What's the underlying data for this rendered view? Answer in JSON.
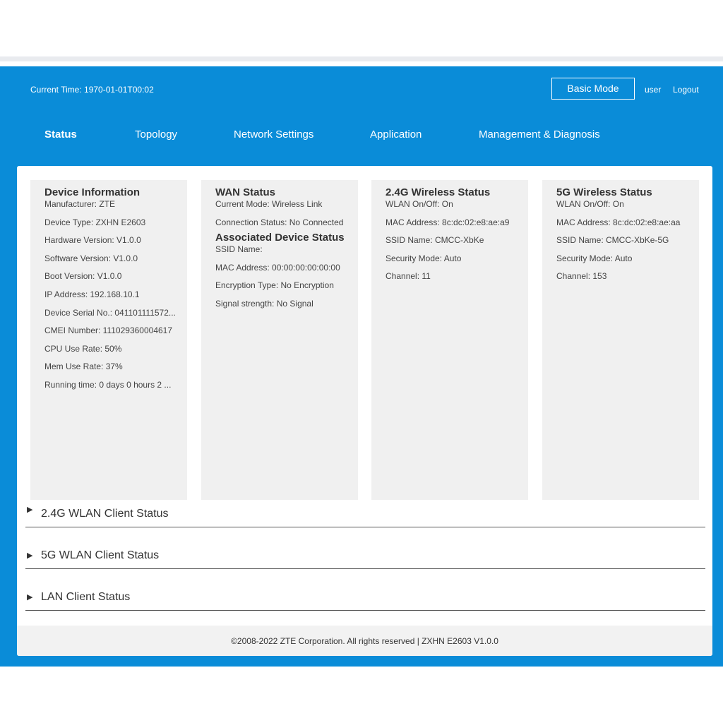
{
  "header": {
    "current_time": "Current Time: 1970-01-01T00:02",
    "basic_mode": "Basic Mode",
    "user": "user",
    "logout": "Logout"
  },
  "nav": [
    {
      "label": "Status",
      "active": true
    },
    {
      "label": "Topology"
    },
    {
      "label": "Network Settings"
    },
    {
      "label": "Application"
    },
    {
      "label": "Management & Diagnosis"
    }
  ],
  "device_info": {
    "title": "Device Information",
    "rows": [
      "Manufacturer: ZTE",
      "Device Type: ZXHN E2603",
      "Hardware Version: V1.0.0",
      "Software Version: V1.0.0",
      "Boot Version: V1.0.0",
      "IP Address: 192.168.10.1",
      "Device Serial No.: 041101111572...",
      "CMEI Number: 111029360004617",
      "CPU Use Rate: 50%",
      "Mem Use Rate: 37%",
      "Running time: 0 days 0 hours 2 ..."
    ]
  },
  "wan_status": {
    "title": "WAN Status",
    "rows": [
      "Current Mode: Wireless Link",
      "Connection Status: No Connected"
    ],
    "assoc_title": "Associated Device Status",
    "assoc_rows": [
      "SSID Name:",
      "MAC Address: 00:00:00:00:00:00",
      "Encryption Type: No Encryption",
      "Signal strength: No Signal"
    ]
  },
  "wireless_24": {
    "title": "2.4G Wireless Status",
    "rows": [
      "WLAN On/Off: On",
      "MAC Address: 8c:dc:02:e8:ae:a9",
      "SSID Name: CMCC-XbKe",
      "Security Mode: Auto",
      "Channel: 11"
    ]
  },
  "wireless_5": {
    "title": "5G Wireless Status",
    "rows": [
      "WLAN On/Off: On",
      "MAC Address: 8c:dc:02:e8:ae:aa",
      "SSID Name: CMCC-XbKe-5G",
      "Security Mode: Auto",
      "Channel: 153"
    ]
  },
  "sections": [
    {
      "arrow": "▶",
      "label": "2.4G WLAN Client Status"
    },
    {
      "arrow": "▶",
      "label": "5G WLAN Client Status"
    },
    {
      "arrow": "▶",
      "label": "LAN Client Status"
    }
  ],
  "footer": {
    "text": "©2008-2022 ZTE Corporation. All rights reserved  |   ZXHN E2603 V1.0.0"
  },
  "colors": {
    "brand_blue": "#0a8cd8",
    "card_bg": "#f0f0f0",
    "footer_bg": "#f2f2f2"
  }
}
